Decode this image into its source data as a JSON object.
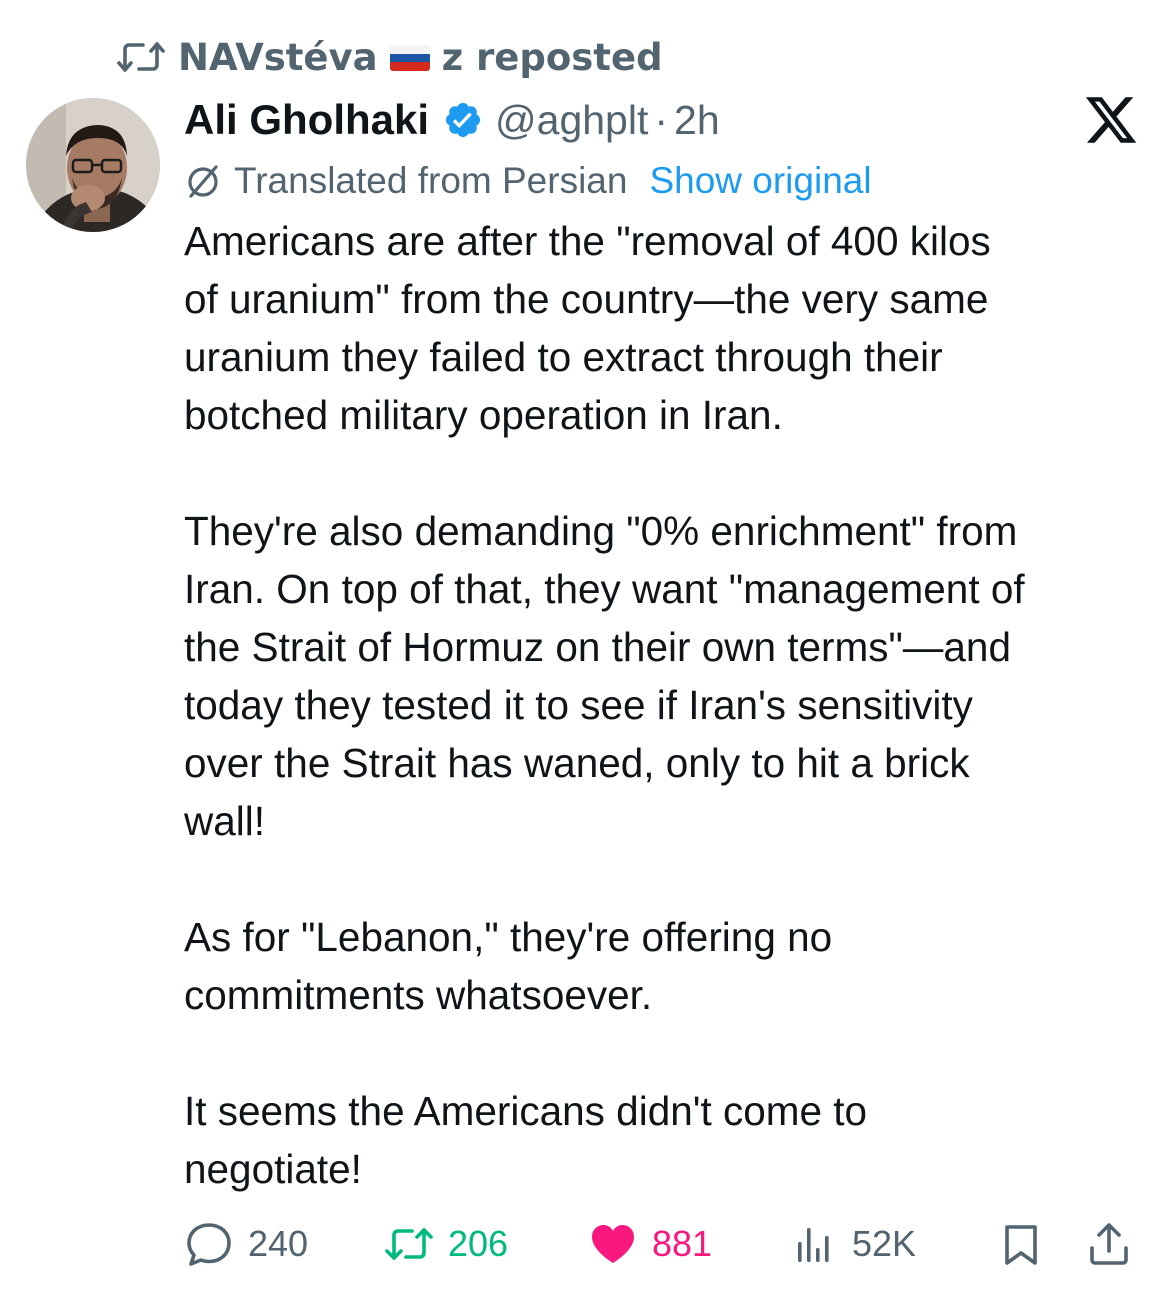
{
  "repost": {
    "name": "NAVstéva",
    "suffix": "z reposted"
  },
  "tweet": {
    "author_name": "Ali Gholhaki",
    "handle": "@aghplt",
    "separator": "·",
    "time": "2h",
    "translated_label": "Translated from Persian",
    "show_original": "Show original",
    "paragraphs": [
      "Americans are after the \"removal of 400 kilos\nof uranium\" from the country—the very same\nuranium they failed to extract through their\nbotched military operation in Iran.",
      "They're also demanding \"0% enrichment\" from\nIran. On top of that, they want \"management of\nthe Strait of Hormuz on their own terms\"—and\ntoday they tested it to see if Iran's sensitivity\nover the Strait has waned, only to hit a brick\nwall!",
      "As for \"Lebanon,\" they're offering no\ncommitments whatsoever.",
      "It seems the Americans didn't come to\nnegotiate!"
    ]
  },
  "actions": {
    "replies": "240",
    "reposts": "206",
    "likes": "881",
    "views": "52K"
  },
  "icons": {
    "repost": "repost-icon",
    "flag": "russia-flag-icon",
    "verified": "verified-badge-icon",
    "logo": "x-logo-icon",
    "translate": "globe-icon",
    "reply": "reply-icon",
    "retweet": "retweet-icon",
    "like": "heart-icon",
    "views": "views-icon",
    "bookmark": "bookmark-icon",
    "share": "share-icon"
  },
  "colors": {
    "text": "#0f1419",
    "secondary": "#536471",
    "link": "#1d9bf0",
    "retweet": "#00ba7c",
    "like": "#f91880"
  }
}
